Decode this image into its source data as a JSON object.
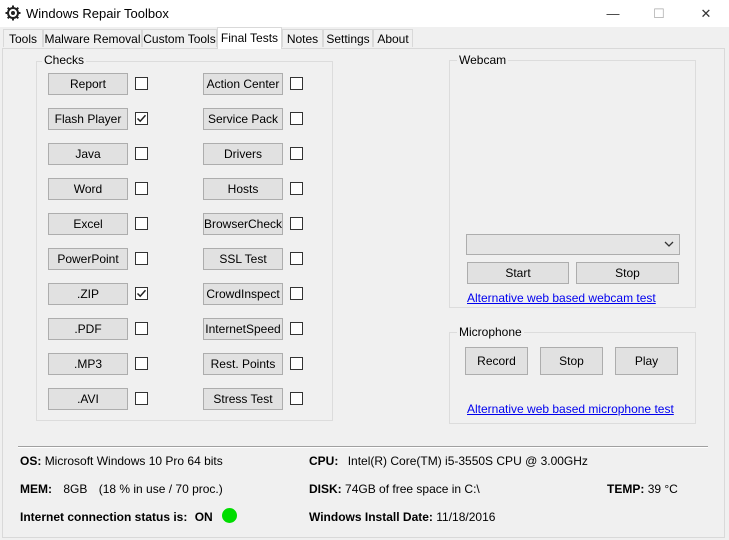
{
  "window": {
    "title": "Windows Repair Toolbox",
    "minimize_glyph": "—",
    "maximize_glyph": "☐",
    "close_glyph": "✕"
  },
  "tabs": [
    {
      "label": "Tools"
    },
    {
      "label": "Malware Removal"
    },
    {
      "label": "Custom Tools"
    },
    {
      "label": "Final Tests"
    },
    {
      "label": "Notes"
    },
    {
      "label": "Settings"
    },
    {
      "label": "About"
    }
  ],
  "active_tab": "Final Tests",
  "checks": {
    "title": "Checks",
    "left": [
      {
        "label": "Report",
        "checked": false
      },
      {
        "label": "Flash Player",
        "checked": true
      },
      {
        "label": "Java",
        "checked": false
      },
      {
        "label": "Word",
        "checked": false
      },
      {
        "label": "Excel",
        "checked": false
      },
      {
        "label": "PowerPoint",
        "checked": false
      },
      {
        "label": ".ZIP",
        "checked": true
      },
      {
        "label": ".PDF",
        "checked": false
      },
      {
        "label": ".MP3",
        "checked": false
      },
      {
        "label": ".AVI",
        "checked": false
      }
    ],
    "right": [
      {
        "label": "Action Center",
        "checked": false
      },
      {
        "label": "Service Pack",
        "checked": false
      },
      {
        "label": "Drivers",
        "checked": false
      },
      {
        "label": "Hosts",
        "checked": false
      },
      {
        "label": "BrowserCheck",
        "checked": false
      },
      {
        "label": "SSL Test",
        "checked": false
      },
      {
        "label": "CrowdInspect",
        "checked": false
      },
      {
        "label": "InternetSpeed",
        "checked": false
      },
      {
        "label": "Rest. Points",
        "checked": false
      },
      {
        "label": "Stress Test",
        "checked": false
      }
    ]
  },
  "webcam": {
    "title": "Webcam",
    "device_select_value": "",
    "start_label": "Start",
    "stop_label": "Stop",
    "alt_link": "Alternative web based webcam test"
  },
  "microphone": {
    "title": "Microphone",
    "record_label": "Record",
    "stop_label": "Stop",
    "play_label": "Play",
    "alt_link": "Alternative web based microphone test"
  },
  "sysinfo": {
    "os_label": "OS:",
    "os_value": "Microsoft Windows 10 Pro 64 bits",
    "cpu_label": "CPU:",
    "cpu_value": "Intel(R) Core(TM) i5-3550S CPU @ 3.00GHz",
    "mem_label": "MEM:",
    "mem_value": "8GB",
    "mem_usage": "(18 % in use / 70 proc.)",
    "disk_label": "DISK:",
    "disk_value": "74GB of free space in C:\\",
    "temp_label": "TEMP:",
    "temp_value": "39 °C",
    "inet_label": "Internet connection status is:",
    "inet_value": "ON",
    "inet_color": "#00dd00",
    "install_label": "Windows Install Date:",
    "install_value": "11/18/2016"
  }
}
